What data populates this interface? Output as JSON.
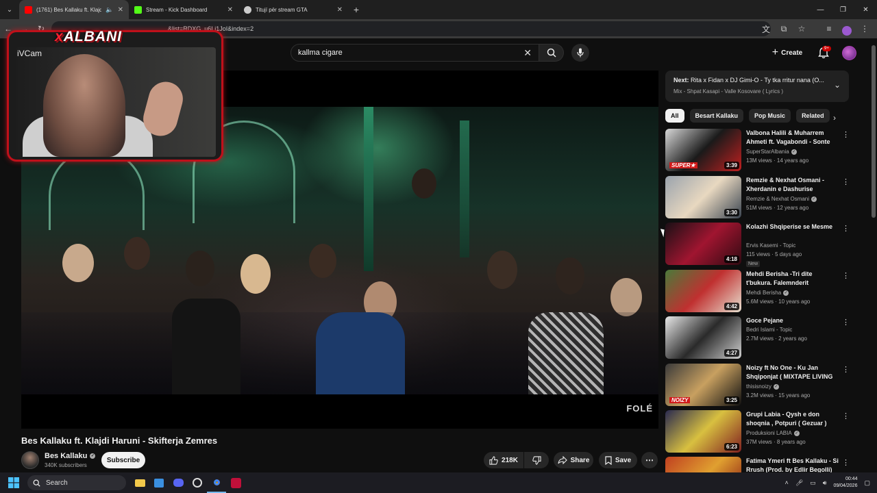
{
  "browser": {
    "tabs": [
      {
        "label": "(1761) Bes Kallaku ft. Klajdi",
        "favicon_color": "#ff0000",
        "active": true,
        "audio": true
      },
      {
        "label": "Stream - Kick Dashboard",
        "favicon_color": "#53fc18",
        "active": false
      },
      {
        "label": "Titují për stream GTA",
        "favicon_color": "#cccccc",
        "active": false
      }
    ],
    "url_visible": "&list=RDXG_u6Li1JoI&index=2"
  },
  "webcam": {
    "label": "iVCam",
    "brand_x": "x",
    "brand_rest": "ALBANI"
  },
  "youtube": {
    "search_value": "kallma cigare",
    "create_label": "Create",
    "notification_count": "9+"
  },
  "video": {
    "watermark": "FOLÉ",
    "title": "Bes Kallaku ft. Klajdi Haruni - Skifterja Zemres",
    "channel": "Bes Kallaku",
    "subscribers": "340K subscribers",
    "subscribe_label": "Subscribe",
    "likes": "218K",
    "share_label": "Share",
    "save_label": "Save"
  },
  "sidebar": {
    "next_label": "Next:",
    "next_title": "Rita x Fidan x DJ Gimi-O - Ty tka rritur nana (O...",
    "next_sub": "Mix - Shpat Kasapi - Valle Kosovare ( Lyrics )",
    "chips": [
      "All",
      "Besart Kallaku",
      "Pop Music",
      "Related"
    ],
    "items": [
      {
        "title": "Valbona Halili & Muharrem Ahmeti ft. Vagabondi - Sonte d...",
        "channel": "SuperStarAlbania",
        "verified": true,
        "meta": "13M views · 14 years ago",
        "duration": "3:39",
        "badge": "SUPER★",
        "c1": "#d8d8d8",
        "c2": "#1a1a1a",
        "c3": "#c02020"
      },
      {
        "title": "Remzie & Nexhat Osmani - Xherdanin e Dashurise",
        "channel": "Remzie & Nexhat Osmani",
        "verified": true,
        "meta": "51M views · 12 years ago",
        "duration": "3:30",
        "badge": "",
        "c1": "#9aa3ad",
        "c2": "#e8d8c0",
        "c3": "#3a4450"
      },
      {
        "title": "Kolazhi Shqiperise se Mesme",
        "channel": "Ervis Kasemi - Topic",
        "verified": false,
        "meta": "115 views · 5 days ago",
        "new": "New",
        "duration": "4:18",
        "badge": "",
        "c1": "#1a1015",
        "c2": "#a01530",
        "c3": "#300a12"
      },
      {
        "title": "Mehdi Berisha -Tri dite t'bukura. Falemnderit Ansamblit folklori...",
        "channel": "Mehdi Berisha",
        "verified": true,
        "meta": "5.6M views · 10 years ago",
        "duration": "4:42",
        "badge": "",
        "c1": "#4a7a3a",
        "c2": "#c03030",
        "c3": "#e8e0d0"
      },
      {
        "title": "Goce Pejane",
        "channel": "Bedri Islami - Topic",
        "verified": false,
        "meta": "2.7M views · 2 years ago",
        "duration": "4:27",
        "badge": "",
        "c1": "#e8e8e8",
        "c2": "#2a2a2a",
        "c3": "#cfcfcf"
      },
      {
        "title": "Noizy ft No One - Ku Jan Shqiponjat ( MIXTAPE LIVING ...",
        "channel": "thisisnoizy",
        "verified": true,
        "meta": "3.2M views · 15 years ago",
        "duration": "3:25",
        "badge": "NOIZY",
        "c1": "#3a3a3a",
        "c2": "#c8a060",
        "c3": "#101010"
      },
      {
        "title": "Grupi Labia - Qysh e don shoqnia , Potpuri ( Gezuar )",
        "channel": "Produksioni LABIA",
        "verified": true,
        "meta": "37M views · 8 years ago",
        "duration": "6:23",
        "badge": "",
        "c1": "#2a2a50",
        "c2": "#d8c040",
        "c3": "#802020"
      },
      {
        "title": "Fatima Ymeri ft Bes Kallaku - Si Rrush (Prod. by Edlir Begolli)",
        "channel": "",
        "verified": false,
        "meta": "",
        "duration": "",
        "badge": "",
        "c1": "#c04020",
        "c2": "#e0a030",
        "c3": "#801010"
      }
    ]
  },
  "taskbar": {
    "search_label": "Search",
    "time": "00:44",
    "date": "09/04/2026"
  }
}
